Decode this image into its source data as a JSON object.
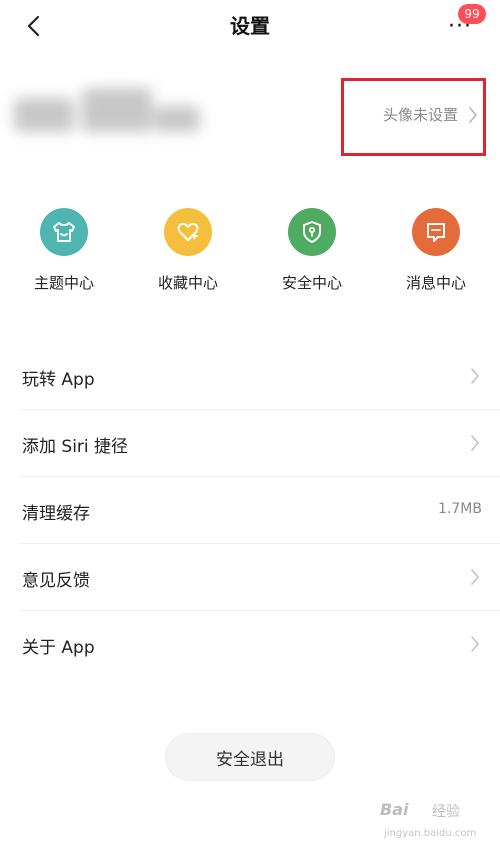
{
  "header": {
    "title": "设置",
    "badge_count": "99"
  },
  "profile": {
    "avatar_hint": "头像未设置"
  },
  "shortcuts": [
    {
      "label": "主题中心",
      "icon": "shirt-icon",
      "color": "#4eb5b1"
    },
    {
      "label": "收藏中心",
      "icon": "heart-icon",
      "color": "#f5bf3e"
    },
    {
      "label": "安全中心",
      "icon": "shield-icon",
      "color": "#4fab62"
    },
    {
      "label": "消息中心",
      "icon": "message-icon",
      "color": "#e36c3a"
    }
  ],
  "menu": [
    {
      "label": "玩转 App",
      "value": ""
    },
    {
      "label": "添加 Siri 捷径",
      "value": ""
    },
    {
      "label": "清理缓存",
      "value": "1.7MB"
    },
    {
      "label": "意见反馈",
      "value": ""
    },
    {
      "label": "关于 App",
      "value": ""
    }
  ],
  "logout_label": "安全退出",
  "watermark": {
    "logo": "Bai",
    "brand": "经验",
    "url": "jingyan.baidu.com"
  },
  "colors": {
    "highlight": "#e0242e",
    "badge": "#ff4d5a"
  }
}
